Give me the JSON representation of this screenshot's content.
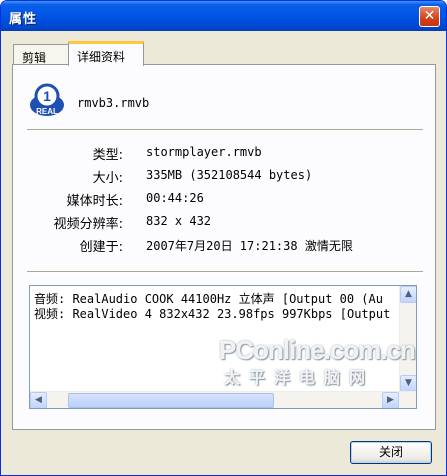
{
  "window": {
    "title": "属性",
    "close_glyph": "✕"
  },
  "tabs": [
    {
      "label": "剪辑",
      "active": false
    },
    {
      "label": "详细资料",
      "active": true
    }
  ],
  "file": {
    "icon": "real-media-icon",
    "icon_text": "REAL",
    "icon_number": "1",
    "name": "rmvb3.rmvb"
  },
  "details": [
    {
      "label": "类型:",
      "value": "stormplayer.rmvb"
    },
    {
      "label": "大小:",
      "value": "335MB (352108544 bytes)"
    },
    {
      "label": "媒体时长:",
      "value": "00:44:26"
    },
    {
      "label": "视频分辨率:",
      "value": "832 x 432"
    },
    {
      "label": "创建于:",
      "value": "2007年7月20日 17:21:38 激情无限"
    }
  ],
  "streams": [
    "音频: RealAudio COOK 44100Hz 立体声 [Output 00 (Au",
    "视频: RealVideo 4 832x432 23.98fps 997Kbps [Output"
  ],
  "watermark": {
    "brand": "PConline.com.cn",
    "cn": "太平洋电脑网"
  },
  "footer": {
    "close_label": "关闭"
  },
  "colors": {
    "titlebar": "#0055e5",
    "accent_tab": "#ffc83c",
    "close_red": "#d2411a"
  }
}
